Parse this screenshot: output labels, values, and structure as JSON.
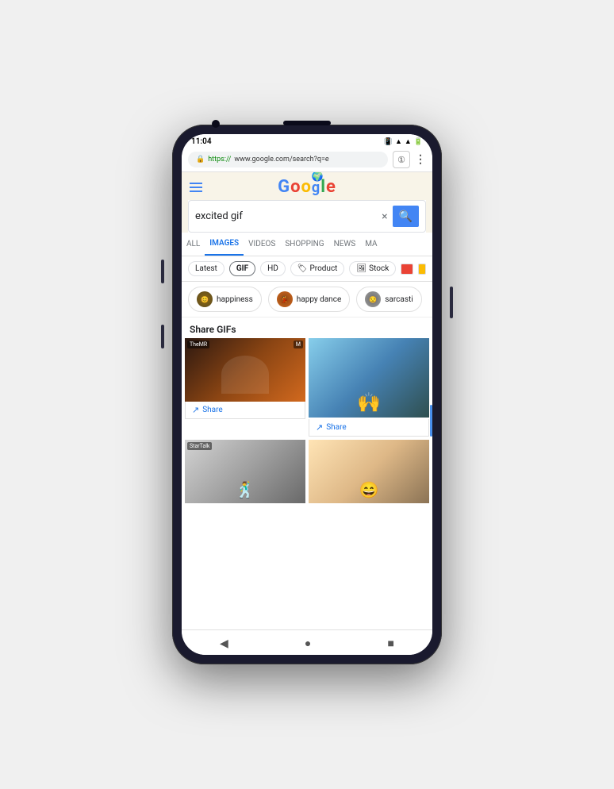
{
  "status_bar": {
    "time": "11:04",
    "icons": [
      "sim",
      "calendar",
      "location",
      "dot"
    ]
  },
  "url_bar": {
    "url": "https://www.google.com/search?q=e",
    "https_label": "https://",
    "domain": "www.google.com/search?q=e",
    "tab_btn": "①",
    "menu_btn": "⋮"
  },
  "google_header": {
    "menu_icon": "☰",
    "logo_text": "G  gle"
  },
  "search": {
    "query": "excited gif",
    "clear_label": "×",
    "search_icon": "🔍"
  },
  "nav_tabs": [
    {
      "label": "ALL",
      "active": false
    },
    {
      "label": "IMAGES",
      "active": true
    },
    {
      "label": "VIDEOS",
      "active": false
    },
    {
      "label": "SHOPPING",
      "active": false
    },
    {
      "label": "NEWS",
      "active": false
    },
    {
      "label": "MA",
      "active": false
    }
  ],
  "filter_chips": [
    {
      "label": "Latest",
      "type": "text"
    },
    {
      "label": "GIF",
      "type": "gif"
    },
    {
      "label": "HD",
      "type": "text"
    },
    {
      "label": "Product",
      "type": "icon-text",
      "icon": "🏷"
    },
    {
      "label": "Stock",
      "type": "icon-text",
      "icon": "🖼"
    },
    {
      "label": "",
      "type": "color"
    }
  ],
  "suggestion_pills": [
    {
      "label": "happiness",
      "emoji": "😊"
    },
    {
      "label": "happy dance",
      "emoji": "💃"
    },
    {
      "label": "sarcasti",
      "emoji": "😒"
    }
  ],
  "share_gifs": {
    "title": "Share GIFs"
  },
  "gifs": [
    {
      "id": 1,
      "label": "TheMR",
      "share_text": "Share",
      "position": "top-left"
    },
    {
      "id": 2,
      "label": "",
      "share_text": "Share",
      "position": "top-right"
    },
    {
      "id": 3,
      "label": "StarTalk",
      "share_text": "",
      "position": "bottom-left"
    },
    {
      "id": 4,
      "label": "",
      "share_text": "",
      "position": "bottom-right"
    }
  ],
  "bottom_nav": {
    "back": "◀",
    "home": "●",
    "recent": "■"
  },
  "colors": {
    "blue": "#4285f4",
    "red": "#ea4335",
    "yellow": "#fbbc04",
    "green": "#34a853",
    "link_blue": "#1a73e8"
  }
}
